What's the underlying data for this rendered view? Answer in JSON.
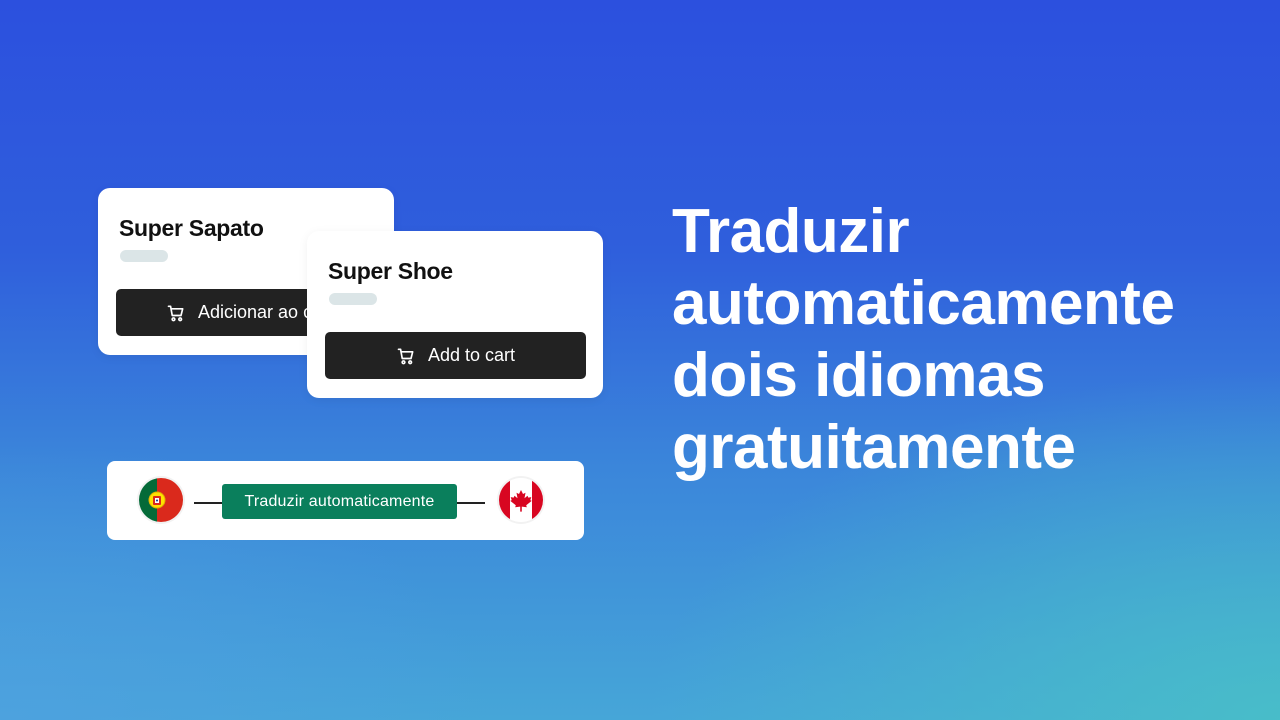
{
  "colors": {
    "background_top": "#2c52de",
    "background_bottom": "#48b6cc",
    "button_dark": "#222222",
    "translate_green": "#0a7f5c",
    "skeleton": "#dbe5e7"
  },
  "product_cards": [
    {
      "language": "pt",
      "title": "Super Sapato",
      "button_label": "Adicionar ao carrinho",
      "button_icon": "cart-icon"
    },
    {
      "language": "en",
      "title": "Super Shoe",
      "button_label": "Add to cart",
      "button_icon": "cart-icon"
    }
  ],
  "translate_bar": {
    "source_flag": "portugal-flag-icon",
    "target_flag": "canada-flag-icon",
    "action_label": "Traduzir automaticamente"
  },
  "headline": {
    "lines": [
      "Traduzir",
      "automaticamente",
      "dois idiomas",
      "gratuitamente"
    ]
  }
}
